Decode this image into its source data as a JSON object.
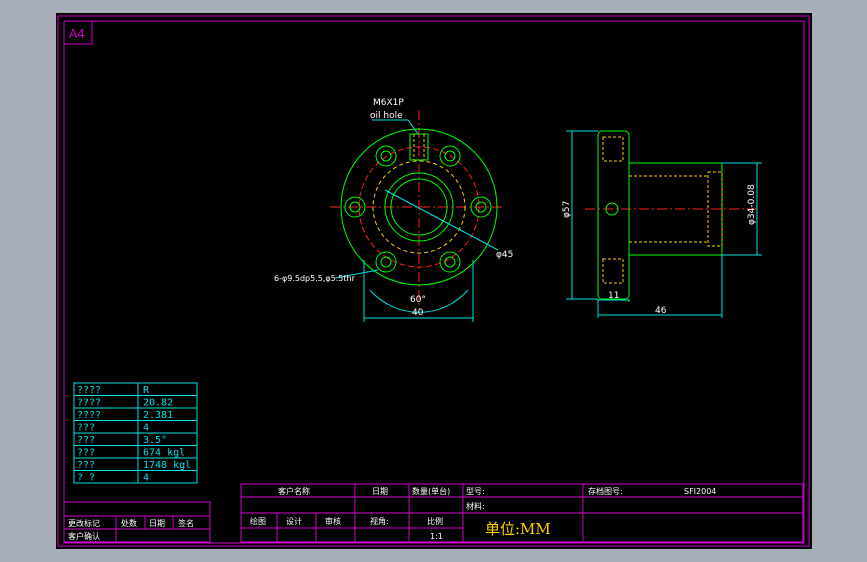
{
  "sheet": {
    "size_label": "A4",
    "colors": {
      "background": "#000000",
      "frame": "#d000d0",
      "part_outline": "#00ff00",
      "dimension": "#00e0e0",
      "center_line": "#ff2020",
      "hidden_line": "#ffd000",
      "text": "#ffffff"
    }
  },
  "front_view": {
    "thread_label": "M6X1P",
    "oil_hole_label": "oil hole",
    "bolt_hole_label": "6-φ9.5dp5.5,φ5.5thr",
    "diameter_label": "φ45",
    "angle_label": "60°",
    "width_label": "40"
  },
  "side_view": {
    "outer_diameter_label": "φ57",
    "body_diameter_label": "φ34-0.08",
    "flange_thickness_label": "11",
    "length_label": "46"
  },
  "spec_table": {
    "rows": [
      {
        "key": "????",
        "value": "R"
      },
      {
        "key": "????",
        "value": "20.82"
      },
      {
        "key": "????",
        "value": "2.381"
      },
      {
        "key": "???",
        "value": "4"
      },
      {
        "key": "???",
        "value": "3.5°"
      },
      {
        "key": "???",
        "value": "674  kgl"
      },
      {
        "key": "???",
        "value": "1748  kgl"
      },
      {
        "key": "?  ?",
        "value": "4"
      }
    ]
  },
  "revision_block": {
    "row1": [
      "更改标记",
      "处数",
      "日期",
      "签名"
    ],
    "row2": [
      "客户确认"
    ]
  },
  "title_block": {
    "customer_name": "客户名称",
    "date": "日期",
    "quantity": "数量(单台)",
    "model": "型号:",
    "material": "材料:",
    "drawing_no_label": "存档图号:",
    "drawing_no": "SFI2004",
    "drawn": "绘图",
    "designed": "设计",
    "checked": "审核",
    "view_angle": "视角:",
    "scale_label": "比例",
    "scale": "1:1",
    "unit": "单位:MM"
  }
}
